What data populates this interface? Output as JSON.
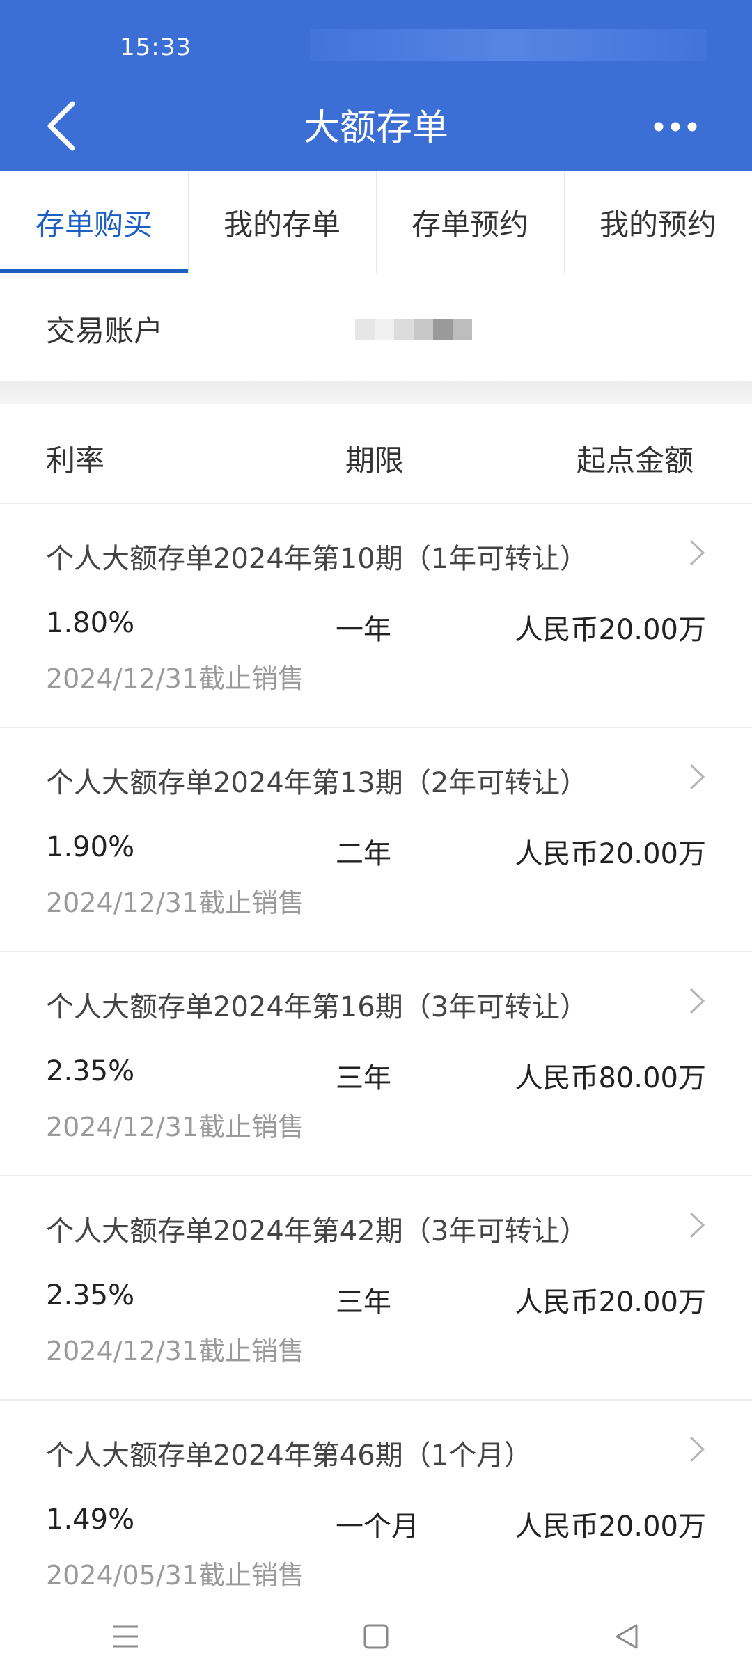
{
  "status_bar": {
    "time": "15:33"
  },
  "header": {
    "title": "大额存单",
    "back_icon": "chevron-left-icon",
    "more_icon": "more-horizontal-icon"
  },
  "tabs": [
    {
      "label": "存单购买",
      "active": true
    },
    {
      "label": "我的存单",
      "active": false
    },
    {
      "label": "存单预约",
      "active": false
    },
    {
      "label": "我的预约",
      "active": false
    }
  ],
  "account": {
    "label": "交易账户"
  },
  "columns": {
    "rate": "利率",
    "term": "期限",
    "min_amount": "起点金额"
  },
  "products": [
    {
      "name": "个人大额存单2024年第10期（1年可转让）",
      "rate": "1.80%",
      "term": "一年",
      "min_amount": "人民币20.00万",
      "deadline": "2024/12/31截止销售"
    },
    {
      "name": "个人大额存单2024年第13期（2年可转让）",
      "rate": "1.90%",
      "term": "二年",
      "min_amount": "人民币20.00万",
      "deadline": "2024/12/31截止销售"
    },
    {
      "name": "个人大额存单2024年第16期（3年可转让）",
      "rate": "2.35%",
      "term": "三年",
      "min_amount": "人民币80.00万",
      "deadline": "2024/12/31截止销售"
    },
    {
      "name": "个人大额存单2024年第42期（3年可转让）",
      "rate": "2.35%",
      "term": "三年",
      "min_amount": "人民币20.00万",
      "deadline": "2024/12/31截止销售"
    },
    {
      "name": "个人大额存单2024年第46期（1个月）",
      "rate": "1.49%",
      "term": "一个月",
      "min_amount": "人民币20.00万",
      "deadline": "2024/05/31截止销售"
    }
  ],
  "nav_bar": {
    "menu_icon": "menu-icon",
    "home_icon": "home-square-icon",
    "back_icon": "back-triangle-icon"
  },
  "colors": {
    "primary": "#3c6fd5",
    "active_tab": "#1d5fc4",
    "muted_text": "#9a9a9a"
  }
}
